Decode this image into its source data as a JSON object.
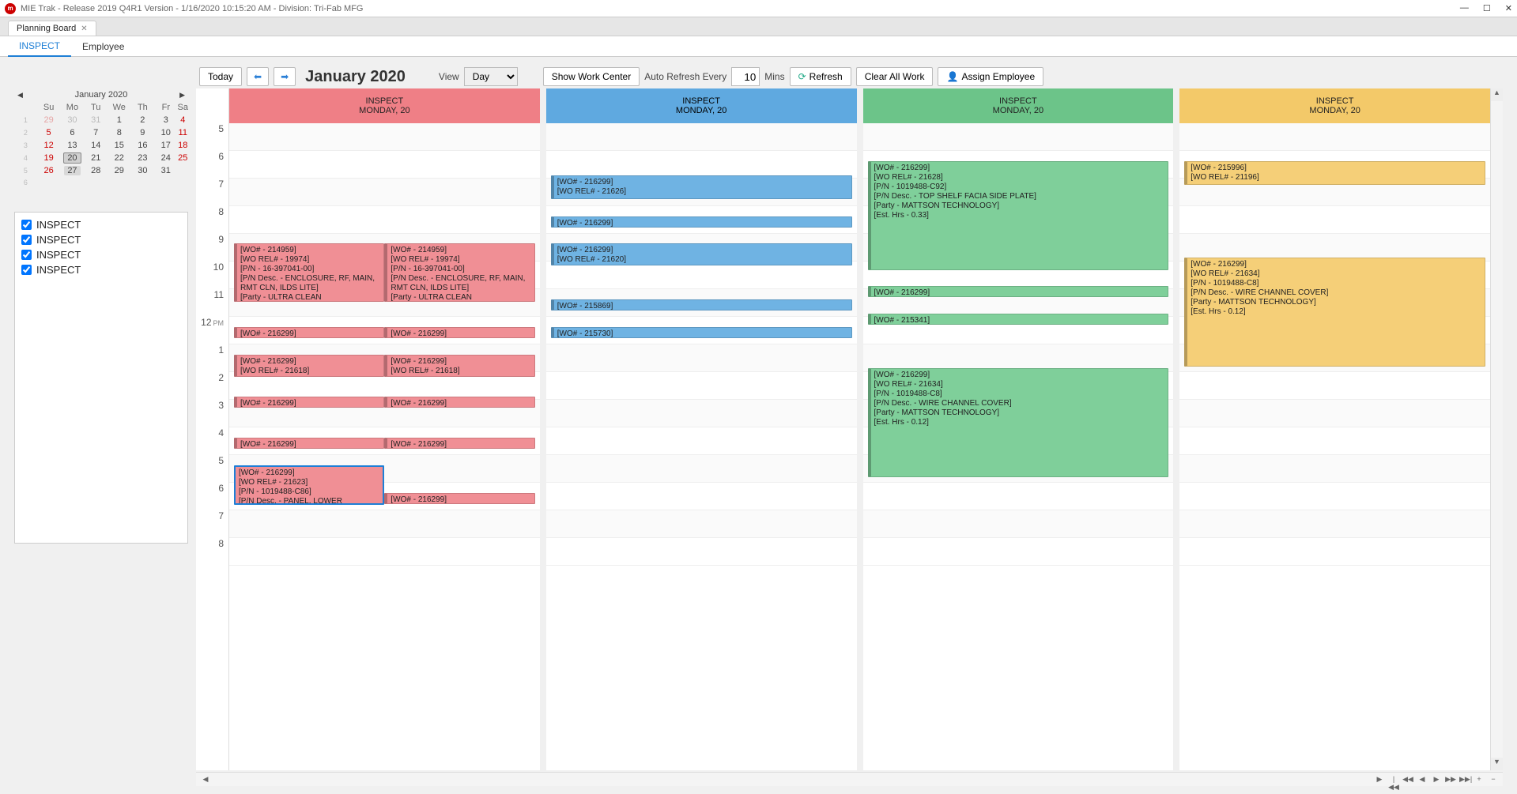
{
  "window": {
    "title": "MIE Trak - Release 2019 Q4R1  Version - 1/16/2020 10:15:20 AM - Division:  Tri-Fab MFG"
  },
  "mainTab": {
    "label": "Planning Board"
  },
  "subtabs": {
    "t0": "INSPECT",
    "t1": "Employee"
  },
  "toolbar": {
    "today": "Today",
    "month": "January 2020",
    "viewlbl": "View",
    "viewval": "Day",
    "showwc": "Show Work Center",
    "autorefresh": "Auto Refresh Every",
    "mins_val": "10",
    "mins": "Mins",
    "refresh": "Refresh",
    "clearall": "Clear All Work",
    "assign": "Assign Employee"
  },
  "minical": {
    "month": "January 2020",
    "dh": {
      "su": "Su",
      "mo": "Mo",
      "tu": "Tu",
      "we": "We",
      "th": "Th",
      "fr": "Fr",
      "sa": "Sa"
    },
    "w1": {
      "n": "1",
      "d0": "29",
      "d1": "30",
      "d2": "31",
      "d3": "1",
      "d4": "2",
      "d5": "3",
      "d6": "4"
    },
    "w2": {
      "n": "2",
      "d0": "5",
      "d1": "6",
      "d2": "7",
      "d3": "8",
      "d4": "9",
      "d5": "10",
      "d6": "11"
    },
    "w3": {
      "n": "3",
      "d0": "12",
      "d1": "13",
      "d2": "14",
      "d3": "15",
      "d4": "16",
      "d5": "17",
      "d6": "18"
    },
    "w4": {
      "n": "4",
      "d0": "19",
      "d1": "20",
      "d2": "21",
      "d3": "22",
      "d4": "23",
      "d5": "24",
      "d6": "25"
    },
    "w5": {
      "n": "5",
      "d0": "26",
      "d1": "27",
      "d2": "28",
      "d3": "29",
      "d4": "30",
      "d5": "31",
      "d6": ""
    }
  },
  "filters": {
    "f0": "INSPECT",
    "f1": "INSPECT",
    "f2": "INSPECT",
    "f3": "INSPECT"
  },
  "hours": {
    "h5": "5",
    "h6": "6",
    "h7": "7",
    "h8": "8",
    "h9": "9",
    "h10": "10",
    "h11": "11",
    "h12": "12",
    "pm": "PM",
    "h13": "1",
    "h14": "2",
    "h15": "3",
    "h16": "4",
    "h17": "5",
    "h18": "6",
    "h19": "7",
    "h20": "8"
  },
  "cols": {
    "c0": {
      "t1": "INSPECT",
      "t2": "MONDAY, 20"
    },
    "c1": {
      "t1": "INSPECT",
      "t2": "MONDAY, 20"
    },
    "c2": {
      "t1": "INSPECT",
      "t2": "MONDAY, 20"
    },
    "c3": {
      "t1": "INSPECT",
      "t2": "MONDAY, 20"
    }
  },
  "events": {
    "c0_1": "[WO# - 214959]\n[WO REL# - 19974]\n[P/N - 16-397041-00]\n[P/N Desc. - ENCLOSURE, RF, MAIN, RMT CLN, ILDS LITE]\n[Party - ULTRA CLEAN",
    "c0_1b": "[WO# - 214959]\n[WO REL# - 19974]\n[P/N - 16-397041-00]\n[P/N Desc. - ENCLOSURE, RF, MAIN, RMT CLN, ILDS LITE]\n[Party - ULTRA CLEAN",
    "c0_2": "[WO# - 216299]",
    "c0_2b": "[WO# - 216299]",
    "c0_3": "[WO# - 216299]\n[WO REL# - 21618]",
    "c0_3b": "[WO# - 216299]\n[WO REL# - 21618]",
    "c0_4": "[WO# - 216299]",
    "c0_4b": "[WO# - 216299]",
    "c0_5": "[WO# - 216299]",
    "c0_5b": "[WO# - 216299]",
    "c0_6": "[WO# - 216299]\n[WO REL# - 21623]\n[P/N - 1019488-C86]\n[P/N Desc. - PANEL, LOWER",
    "c0_6b": "[WO# - 216299]",
    "c1_1": "[WO# - 216299]\n[WO REL# - 21626]",
    "c1_2": "[WO# - 216299]",
    "c1_3": "[WO# - 216299]\n[WO REL# - 21620]",
    "c1_4": "[WO# - 215869]",
    "c1_5": "[WO# - 215730]",
    "c2_1": "[WO# - 216299]\n[WO REL# - 21628]\n[P/N - 1019488-C92]\n[P/N Desc. - TOP SHELF FACIA SIDE PLATE]\n[Party - MATTSON TECHNOLOGY]\n[Est. Hrs - 0.33]",
    "c2_2": "[WO# - 216299]",
    "c2_3": "[WO# - 215341]",
    "c2_4": "[WO# - 216299]\n[WO REL# - 21634]\n[P/N - 1019488-C8]\n[P/N Desc. - WIRE CHANNEL COVER]\n[Party - MATTSON TECHNOLOGY]\n[Est. Hrs - 0.12]",
    "c3_1": "[WO# - 215996]\n[WO REL# - 21196]",
    "c3_2": "[WO# - 216299]\n[WO REL# - 21634]\n[P/N - 1019488-C8]\n[P/N Desc. - WIRE CHANNEL COVER]\n[Party - MATTSON TECHNOLOGY]\n[Est. Hrs - 0.12]"
  }
}
